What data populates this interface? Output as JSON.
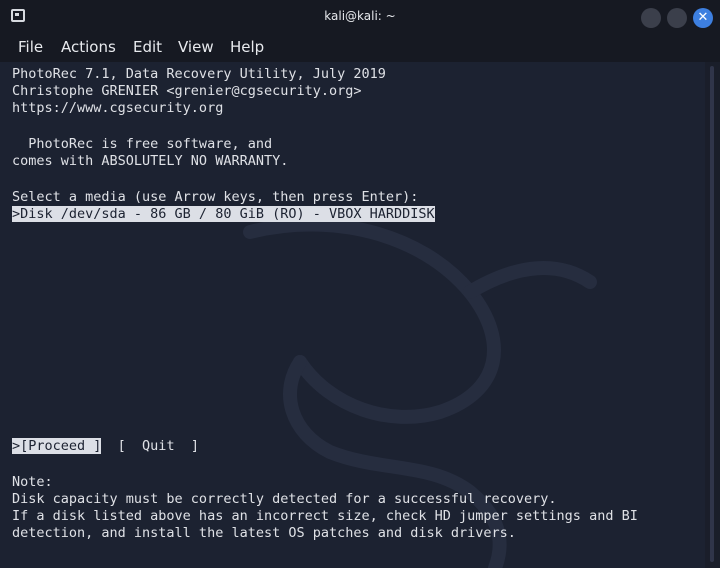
{
  "window": {
    "title": "kali@kali: ~"
  },
  "menu": {
    "file": "File",
    "actions": "Actions",
    "edit": "Edit",
    "view": "View",
    "help": "Help"
  },
  "terminal": {
    "header_line1": "PhotoRec 7.1, Data Recovery Utility, July 2019",
    "header_line2": "Christophe GRENIER <grenier@cgsecurity.org>",
    "header_line3": "https://www.cgsecurity.org",
    "license_line1": "  PhotoRec is free software, and",
    "license_line2": "comes with ABSOLUTELY NO WARRANTY.",
    "prompt": "Select a media (use Arrow keys, then press Enter):",
    "media_selected": ">Disk /dev/sda - 86 GB / 80 GiB (RO) - VBOX HARDDISK",
    "proceed_button": ">[Proceed ]",
    "quit_button": "[  Quit  ]",
    "note_label": "Note:",
    "note_line1": "Disk capacity must be correctly detected for a successful recovery.",
    "note_line2": "If a disk listed above has an incorrect size, check HD jumper settings and BI",
    "note_line3": "detection, and install the latest OS patches and disk drivers."
  },
  "colors": {
    "background": "#1c2231",
    "text": "#dfe1e6",
    "selection_background": "#dcdfe6",
    "close_button": "#3d7fe0"
  },
  "icons": {
    "app_icon": "terminal-icon",
    "close": "close-icon"
  }
}
